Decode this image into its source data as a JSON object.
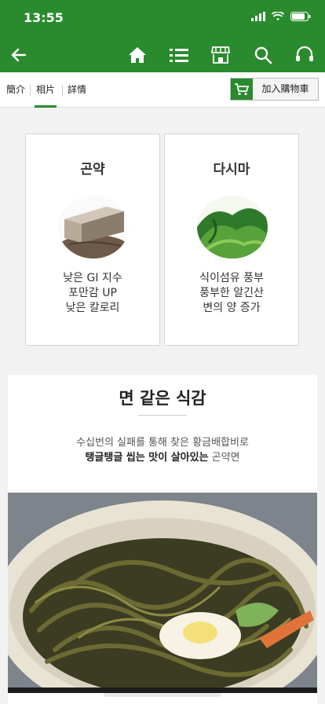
{
  "status_bar": {
    "time": "13:55"
  },
  "nav": {
    "back_icon": "arrow-left-icon",
    "home_icon": "home-icon",
    "menu_icon": "list-icon",
    "store_icon": "store-icon",
    "search_icon": "search-icon",
    "support_icon": "headset-icon"
  },
  "tabs": [
    {
      "label": "簡介"
    },
    {
      "label": "相片"
    },
    {
      "label": "詳情"
    }
  ],
  "active_tab": "相片",
  "cart_button": {
    "label": "加入購物車",
    "icon": "cart-icon"
  },
  "cards": [
    {
      "title": "곤약",
      "lines": [
        "낮은 GI 지수",
        "포만감 UP",
        "낮은 칼로리"
      ]
    },
    {
      "title": "다시마",
      "lines": [
        "식이섬유 풍부",
        "풍부한 알긴산",
        "변의 양 증가"
      ]
    }
  ],
  "section": {
    "title": "면 같은 식감",
    "line1": "수십번의 실패를 통해 찾은 황금배합비로",
    "line2_bold": "탱글탱글 씹는 맛이 살아있는",
    "line2_rest": " 곤약면"
  },
  "colors": {
    "brand_green": "#2a8a2e"
  }
}
